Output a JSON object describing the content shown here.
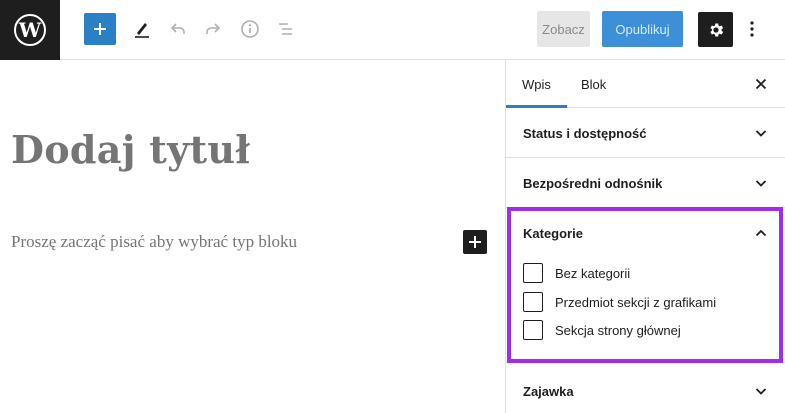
{
  "toolbar": {
    "preview_label": "Zobacz",
    "publish_label": "Opublikuj",
    "icons": [
      "wordpress-logo",
      "plus-icon",
      "pencil-icon",
      "undo-icon",
      "redo-icon",
      "info-icon",
      "list-view-icon",
      "gear-icon",
      "more-vertical-icon"
    ]
  },
  "editor": {
    "title_placeholder": "Dodaj tytuł",
    "block_placeholder": "Proszę zacząć pisać aby wybrać typ bloku"
  },
  "sidebar": {
    "tabs": [
      {
        "label": "Wpis",
        "active": true
      },
      {
        "label": "Blok",
        "active": false
      }
    ],
    "panels": {
      "status": "Status i dostępność",
      "permalink": "Bezpośredni odnośnik",
      "categories": "Kategorie",
      "excerpt": "Zajawka"
    },
    "categories": [
      {
        "label": "Bez kategorii",
        "checked": false
      },
      {
        "label": "Przedmiot sekcji z grafikami",
        "checked": false
      },
      {
        "label": "Sekcja strony głównej",
        "checked": false
      }
    ]
  },
  "colors": {
    "accent": "#2b7fc4",
    "highlight": "#a12cf0",
    "dark": "#1e1e1e"
  }
}
